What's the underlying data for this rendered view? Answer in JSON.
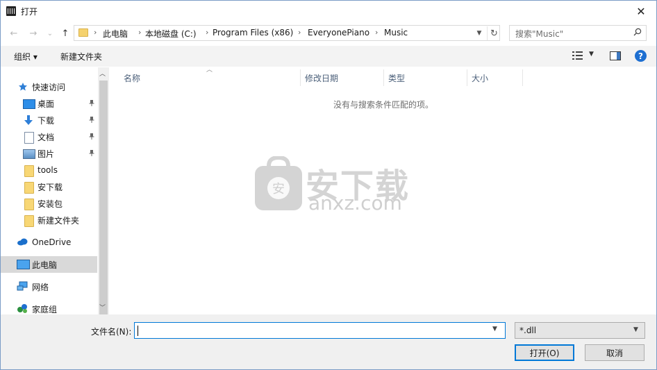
{
  "window": {
    "title": "打开",
    "close_glyph": "✕"
  },
  "nav": {
    "back_glyph": "←",
    "forward_glyph": "→",
    "recent_glyph": "⌄",
    "up_glyph": "↑",
    "breadcrumb": [
      "此电脑",
      "本地磁盘 (C:)",
      "Program Files (x86)",
      "EveryonePiano",
      "Music"
    ],
    "separator": "›",
    "refresh_glyph": "↻",
    "search_placeholder": "搜索\"Music\""
  },
  "toolbar": {
    "organize_label": "组织 ▾",
    "new_folder_label": "新建文件夹",
    "help_glyph": "?"
  },
  "sidebar": {
    "quick_access": "快速访问",
    "items": [
      {
        "label": "桌面",
        "icon": "desktop-icon",
        "pinned": true
      },
      {
        "label": "下载",
        "icon": "download-icon",
        "pinned": true
      },
      {
        "label": "文档",
        "icon": "document-icon",
        "pinned": true
      },
      {
        "label": "图片",
        "icon": "picture-icon",
        "pinned": true
      },
      {
        "label": "tools",
        "icon": "folder-icon",
        "pinned": false
      },
      {
        "label": "安下载",
        "icon": "folder-icon",
        "pinned": false
      },
      {
        "label": "安装包",
        "icon": "folder-icon",
        "pinned": false
      },
      {
        "label": "新建文件夹",
        "icon": "folder-icon",
        "pinned": false
      }
    ],
    "onedrive": "OneDrive",
    "this_pc": "此电脑",
    "network": "网络",
    "homegroup": "家庭组",
    "pin_glyph": "📌"
  },
  "filelist": {
    "columns": [
      "名称",
      "修改日期",
      "类型",
      "大小"
    ],
    "empty_message": "没有与搜索条件匹配的项。"
  },
  "watermark": {
    "cn": "安下载",
    "en": "anxz.com",
    "shield_char": "安"
  },
  "footer": {
    "filename_label": "文件名(N):",
    "filename_value": "",
    "filter_value": "*.dll",
    "open_label": "打开(O)",
    "cancel_label": "取消"
  },
  "colors": {
    "accent": "#0078d7",
    "selected_bg": "#cce8ff",
    "watermark": "#d4d4d4"
  }
}
